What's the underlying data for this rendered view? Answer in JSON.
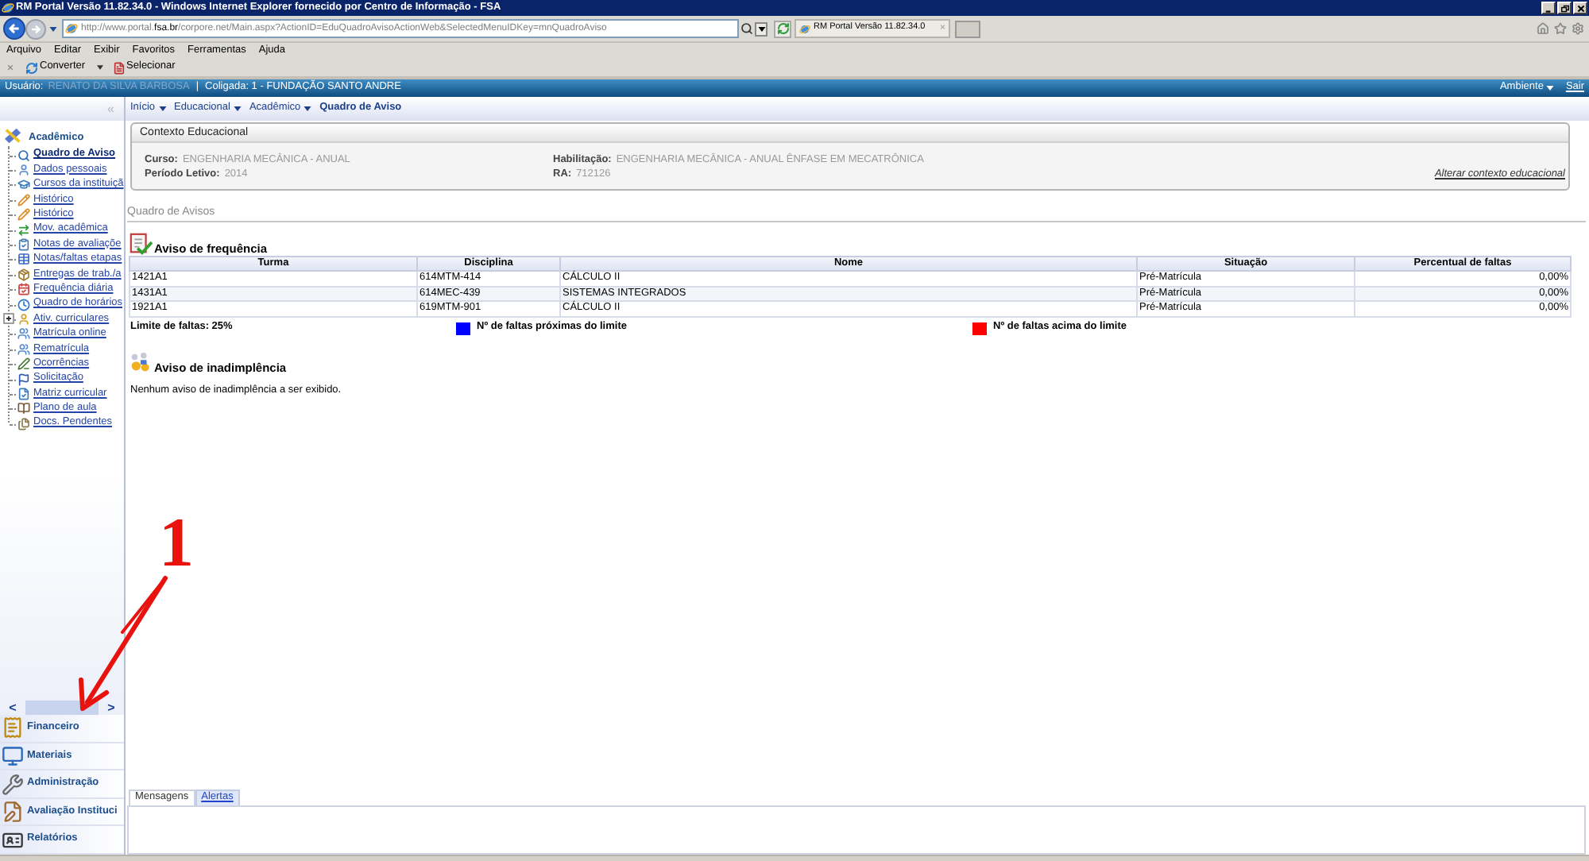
{
  "window": {
    "title": "RM Portal Versão 11.82.34.0 - Windows Internet Explorer fornecido por Centro de Informação - FSA"
  },
  "browser": {
    "address": "http://www.portal.**fsa.br**/corpore.net/Main.aspx?ActionID=EduQuadroAvisoActionWeb&SelectedMenuIDKey=mnQuadroAviso",
    "tab": {
      "label": "RM Portal Versão 11.82.34.0",
      "close": "×"
    },
    "menu": [
      "Arquivo",
      "Editar",
      "Exibir",
      "Favoritos",
      "Ferramentas",
      "Ajuda"
    ],
    "commands": [
      {
        "label": "Converter",
        "dropdown": true
      },
      {
        "label": "Selecionar",
        "dropdown": false
      }
    ]
  },
  "portal_header": {
    "user_label": "Usuário:",
    "user_name": "RENATO DA SILVA BARBOSA",
    "separator": "|",
    "company": "Coligada: 1 - FUNDAÇÃO SANTO ANDRE",
    "environment": "Ambiente",
    "logout": "Sair"
  },
  "breadcrumb": [
    "Início",
    "Educacional",
    "Acadêmico",
    "Quadro de Aviso"
  ],
  "sidebar": {
    "collapse": "«",
    "section": "Acadêmico",
    "items": [
      {
        "label": "Quadro de Aviso",
        "kind": "leaf",
        "selected": true
      },
      {
        "label": "Dados pessoais",
        "kind": "leaf",
        "selected": false
      },
      {
        "label": "Cursos da instituiçã",
        "kind": "leaf",
        "selected": false
      },
      {
        "label": "Histórico",
        "kind": "leaf",
        "selected": false
      },
      {
        "label": "Histórico",
        "kind": "leaf",
        "selected": false
      },
      {
        "label": "Mov. acadêmica",
        "kind": "leaf",
        "selected": false
      },
      {
        "label": "Notas de avaliaçõe",
        "kind": "leaf",
        "selected": false
      },
      {
        "label": "Notas/faltas etapas",
        "kind": "leaf",
        "selected": false
      },
      {
        "label": "Entregas de trab./a",
        "kind": "leaf",
        "selected": false
      },
      {
        "label": "Frequência diária",
        "kind": "leaf",
        "selected": false
      },
      {
        "label": "Quadro de horários",
        "kind": "leaf",
        "selected": false
      },
      {
        "label": "Ativ. curriculares",
        "kind": "folder",
        "selected": false
      },
      {
        "label": "Matrícula online",
        "kind": "leaf",
        "selected": false
      },
      {
        "label": "Rematrícula",
        "kind": "leaf",
        "selected": false
      },
      {
        "label": "Ocorrências",
        "kind": "leaf",
        "selected": false
      },
      {
        "label": "Solicitação",
        "kind": "leaf",
        "selected": false
      },
      {
        "label": "Matriz curricular",
        "kind": "leaf",
        "selected": false
      },
      {
        "label": "Plano de aula",
        "kind": "leaf",
        "selected": false
      },
      {
        "label": "Docs. Pendentes",
        "kind": "leaf",
        "selected": false
      }
    ],
    "scroll": {
      "prev": "<",
      "next": ">"
    },
    "modules": [
      "Financeiro",
      "Materiais",
      "Administração",
      "Avaliação Instituci",
      "Relatórios"
    ]
  },
  "context": {
    "title": "Contexto Educacional",
    "fields": [
      {
        "label": "Curso:",
        "value": "ENGENHARIA MECÂNICA - ANUAL"
      },
      {
        "label": "Habilitação:",
        "value": "ENGENHARIA MECÂNICA - ANUAL ÊNFASE EM MECATRÔNICA"
      },
      {
        "label": "Período Letivo:",
        "value": "2014"
      },
      {
        "label": "RA:",
        "value": "712126"
      }
    ],
    "link": "Alterar contexto educacional"
  },
  "notice_board": {
    "title": "Quadro de Avisos",
    "attendance": {
      "title": "Aviso de frequência",
      "columns": [
        "Turma",
        "Disciplina",
        "Nome",
        "Situação",
        "Percentual de faltas"
      ],
      "rows": [
        [
          "1421A1",
          "614MTM-414",
          "CÁLCULO II",
          "Pré-Matrícula",
          "0,00%"
        ],
        [
          "1431A1",
          "614MEC-439",
          "SISTEMAS INTEGRADOS",
          "Pré-Matrícula",
          "0,00%"
        ],
        [
          "1921A1",
          "619MTM-901",
          "CÁLCULO II",
          "Pré-Matrícula",
          "0,00%"
        ]
      ],
      "limit": "Limite de faltas: 25%",
      "legend": [
        {
          "label": "Nº de faltas próximas do limite",
          "color": "#0000ff"
        },
        {
          "label": "Nº de faltas acima do limite",
          "color": "#ff0000"
        }
      ]
    },
    "default": {
      "title": "Aviso de inadimplência",
      "message": "Nenhum aviso de inadimplência a ser exibido."
    }
  },
  "bottom_tabs": [
    {
      "label": "Mensagens",
      "selected": true
    },
    {
      "label": "Alertas",
      "selected": false
    }
  ],
  "annotation": {
    "label": "1"
  }
}
